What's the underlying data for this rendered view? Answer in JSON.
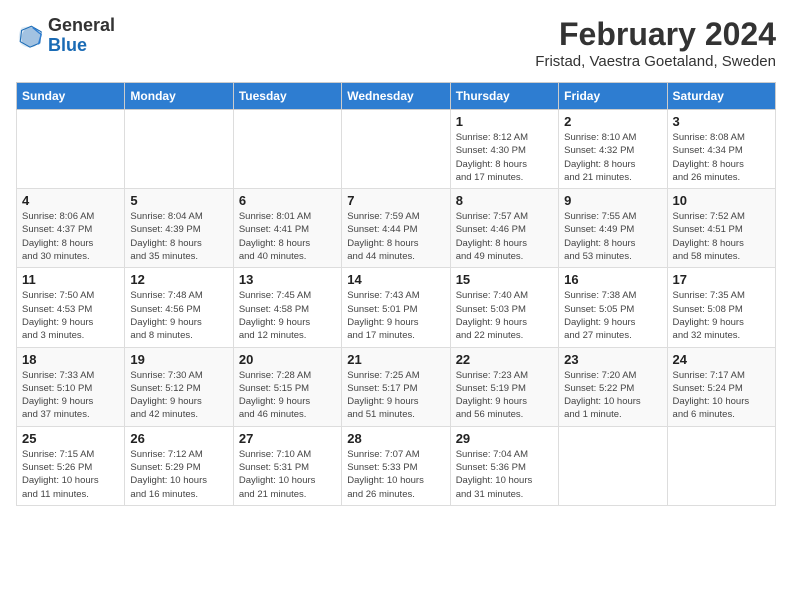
{
  "header": {
    "logo_line1": "General",
    "logo_line2": "Blue",
    "title": "February 2024",
    "subtitle": "Fristad, Vaestra Goetaland, Sweden"
  },
  "weekdays": [
    "Sunday",
    "Monday",
    "Tuesday",
    "Wednesday",
    "Thursday",
    "Friday",
    "Saturday"
  ],
  "weeks": [
    [
      {
        "day": "",
        "info": ""
      },
      {
        "day": "",
        "info": ""
      },
      {
        "day": "",
        "info": ""
      },
      {
        "day": "",
        "info": ""
      },
      {
        "day": "1",
        "info": "Sunrise: 8:12 AM\nSunset: 4:30 PM\nDaylight: 8 hours\nand 17 minutes."
      },
      {
        "day": "2",
        "info": "Sunrise: 8:10 AM\nSunset: 4:32 PM\nDaylight: 8 hours\nand 21 minutes."
      },
      {
        "day": "3",
        "info": "Sunrise: 8:08 AM\nSunset: 4:34 PM\nDaylight: 8 hours\nand 26 minutes."
      }
    ],
    [
      {
        "day": "4",
        "info": "Sunrise: 8:06 AM\nSunset: 4:37 PM\nDaylight: 8 hours\nand 30 minutes."
      },
      {
        "day": "5",
        "info": "Sunrise: 8:04 AM\nSunset: 4:39 PM\nDaylight: 8 hours\nand 35 minutes."
      },
      {
        "day": "6",
        "info": "Sunrise: 8:01 AM\nSunset: 4:41 PM\nDaylight: 8 hours\nand 40 minutes."
      },
      {
        "day": "7",
        "info": "Sunrise: 7:59 AM\nSunset: 4:44 PM\nDaylight: 8 hours\nand 44 minutes."
      },
      {
        "day": "8",
        "info": "Sunrise: 7:57 AM\nSunset: 4:46 PM\nDaylight: 8 hours\nand 49 minutes."
      },
      {
        "day": "9",
        "info": "Sunrise: 7:55 AM\nSunset: 4:49 PM\nDaylight: 8 hours\nand 53 minutes."
      },
      {
        "day": "10",
        "info": "Sunrise: 7:52 AM\nSunset: 4:51 PM\nDaylight: 8 hours\nand 58 minutes."
      }
    ],
    [
      {
        "day": "11",
        "info": "Sunrise: 7:50 AM\nSunset: 4:53 PM\nDaylight: 9 hours\nand 3 minutes."
      },
      {
        "day": "12",
        "info": "Sunrise: 7:48 AM\nSunset: 4:56 PM\nDaylight: 9 hours\nand 8 minutes."
      },
      {
        "day": "13",
        "info": "Sunrise: 7:45 AM\nSunset: 4:58 PM\nDaylight: 9 hours\nand 12 minutes."
      },
      {
        "day": "14",
        "info": "Sunrise: 7:43 AM\nSunset: 5:01 PM\nDaylight: 9 hours\nand 17 minutes."
      },
      {
        "day": "15",
        "info": "Sunrise: 7:40 AM\nSunset: 5:03 PM\nDaylight: 9 hours\nand 22 minutes."
      },
      {
        "day": "16",
        "info": "Sunrise: 7:38 AM\nSunset: 5:05 PM\nDaylight: 9 hours\nand 27 minutes."
      },
      {
        "day": "17",
        "info": "Sunrise: 7:35 AM\nSunset: 5:08 PM\nDaylight: 9 hours\nand 32 minutes."
      }
    ],
    [
      {
        "day": "18",
        "info": "Sunrise: 7:33 AM\nSunset: 5:10 PM\nDaylight: 9 hours\nand 37 minutes."
      },
      {
        "day": "19",
        "info": "Sunrise: 7:30 AM\nSunset: 5:12 PM\nDaylight: 9 hours\nand 42 minutes."
      },
      {
        "day": "20",
        "info": "Sunrise: 7:28 AM\nSunset: 5:15 PM\nDaylight: 9 hours\nand 46 minutes."
      },
      {
        "day": "21",
        "info": "Sunrise: 7:25 AM\nSunset: 5:17 PM\nDaylight: 9 hours\nand 51 minutes."
      },
      {
        "day": "22",
        "info": "Sunrise: 7:23 AM\nSunset: 5:19 PM\nDaylight: 9 hours\nand 56 minutes."
      },
      {
        "day": "23",
        "info": "Sunrise: 7:20 AM\nSunset: 5:22 PM\nDaylight: 10 hours\nand 1 minute."
      },
      {
        "day": "24",
        "info": "Sunrise: 7:17 AM\nSunset: 5:24 PM\nDaylight: 10 hours\nand 6 minutes."
      }
    ],
    [
      {
        "day": "25",
        "info": "Sunrise: 7:15 AM\nSunset: 5:26 PM\nDaylight: 10 hours\nand 11 minutes."
      },
      {
        "day": "26",
        "info": "Sunrise: 7:12 AM\nSunset: 5:29 PM\nDaylight: 10 hours\nand 16 minutes."
      },
      {
        "day": "27",
        "info": "Sunrise: 7:10 AM\nSunset: 5:31 PM\nDaylight: 10 hours\nand 21 minutes."
      },
      {
        "day": "28",
        "info": "Sunrise: 7:07 AM\nSunset: 5:33 PM\nDaylight: 10 hours\nand 26 minutes."
      },
      {
        "day": "29",
        "info": "Sunrise: 7:04 AM\nSunset: 5:36 PM\nDaylight: 10 hours\nand 31 minutes."
      },
      {
        "day": "",
        "info": ""
      },
      {
        "day": "",
        "info": ""
      }
    ]
  ]
}
